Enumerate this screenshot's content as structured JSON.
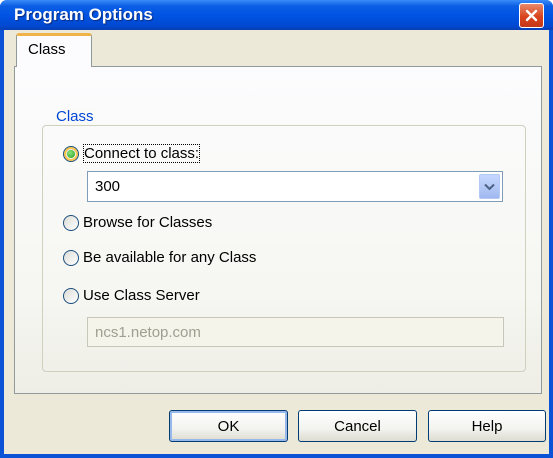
{
  "window": {
    "title": "Program Options",
    "close_icon": "close-icon"
  },
  "tabs": [
    {
      "label": "Class",
      "selected": true
    }
  ],
  "group": {
    "label": "Class"
  },
  "options": {
    "connect": {
      "label": "Connect to class:",
      "checked": true
    },
    "browse": {
      "label": "Browse for Classes",
      "checked": false
    },
    "any": {
      "label": "Be available for any Class",
      "checked": false
    },
    "server": {
      "label": "Use Class Server",
      "checked": false
    }
  },
  "class_combo": {
    "value": "300",
    "icon": "chevron-down-icon"
  },
  "server_field": {
    "value": "ncs1.netop.com",
    "disabled": true
  },
  "buttons": {
    "ok": "OK",
    "cancel": "Cancel",
    "help": "Help"
  },
  "colors": {
    "title_bar": "#0054e3",
    "dialog_face": "#ece9d8",
    "tab_highlight": "#f0b24a",
    "group_label": "#0046d5",
    "close_button": "#d9441d"
  }
}
